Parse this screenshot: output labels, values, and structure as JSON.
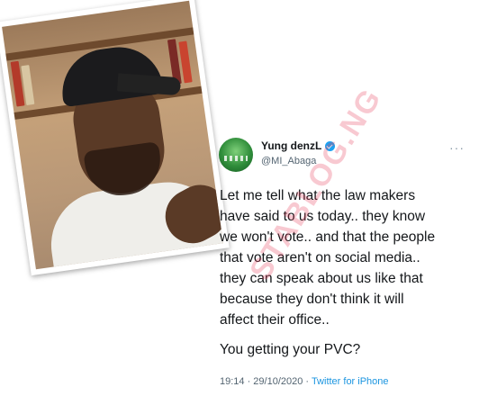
{
  "tweet": {
    "display_name": "Yung denzL",
    "handle": "@MI_Abaga",
    "more_icon": "more-dots-icon",
    "body_lines": [
      "Let me tell what the law makers",
      "have said to us today.. they know",
      "we won't vote.. and that the people",
      "that vote aren't on social media..",
      "they can speak about us like that",
      "because they don't think it will",
      "affect their office.."
    ],
    "question": "You getting your PVC?",
    "time": "19:14 · 29/10/2020 ·",
    "source": "Twitter for iPhone",
    "verified_color": "#1da1f2"
  },
  "watermark": {
    "text": "STABLOG.NG",
    "color": "#e63c5a"
  }
}
